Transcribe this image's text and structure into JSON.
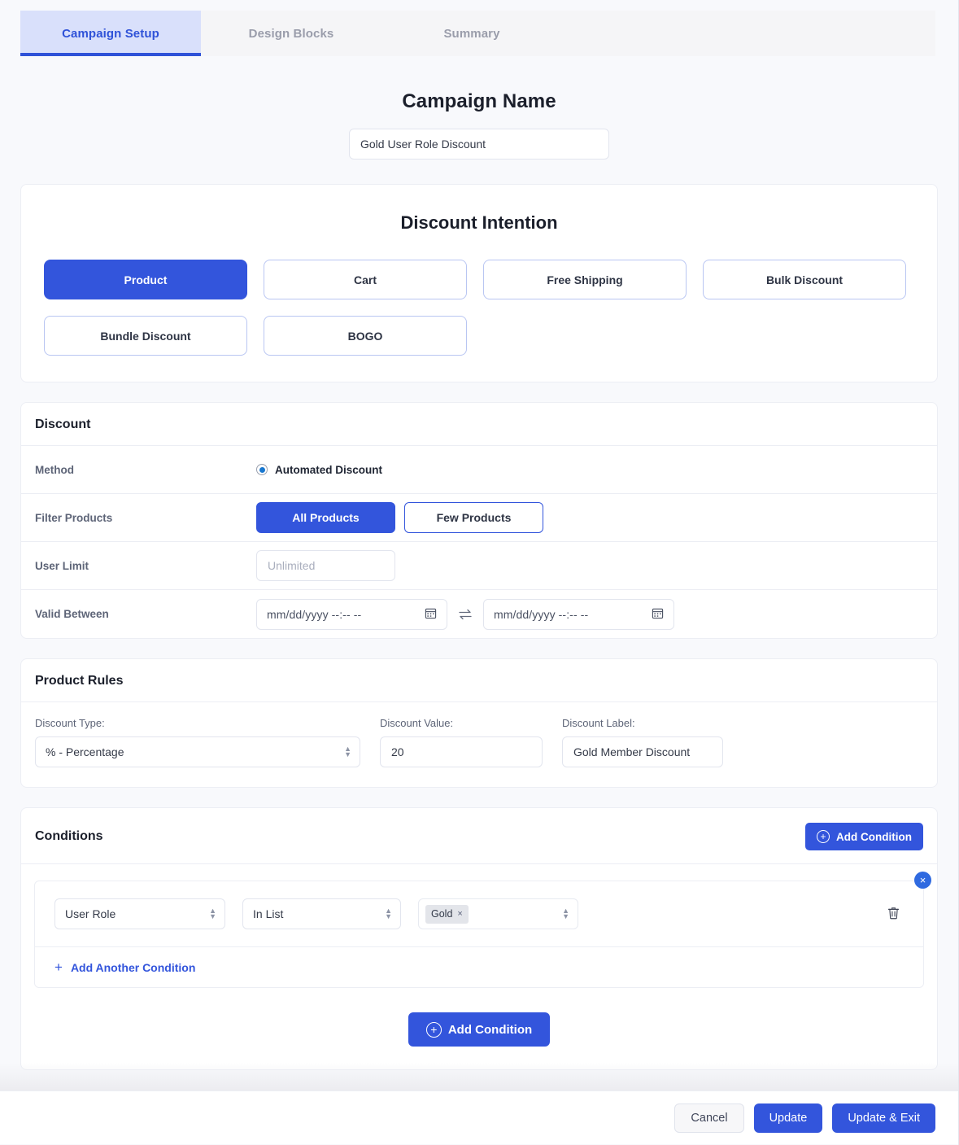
{
  "tabs": [
    {
      "label": "Campaign Setup",
      "active": true
    },
    {
      "label": "Design Blocks",
      "active": false
    },
    {
      "label": "Summary",
      "active": false
    }
  ],
  "campaign": {
    "title": "Campaign Name",
    "name_value": "Gold User Role Discount",
    "name_placeholder": "Campaign Name"
  },
  "intention": {
    "title": "Discount Intention",
    "options": [
      {
        "label": "Product",
        "selected": true
      },
      {
        "label": "Cart",
        "selected": false
      },
      {
        "label": "Free Shipping",
        "selected": false
      },
      {
        "label": "Bulk Discount",
        "selected": false
      },
      {
        "label": "Bundle Discount",
        "selected": false
      },
      {
        "label": "BOGO",
        "selected": false
      }
    ]
  },
  "discount": {
    "section_title": "Discount",
    "method_label": "Method",
    "method_option": "Automated Discount",
    "filter_label": "Filter Products",
    "filter_all": "All Products",
    "filter_few": "Few Products",
    "user_limit_label": "User Limit",
    "user_limit_placeholder": "Unlimited",
    "user_limit_value": "",
    "valid_between_label": "Valid Between",
    "date_from_placeholder": "mm/dd/yyyy --:-- --",
    "date_to_placeholder": "mm/dd/yyyy --:-- --"
  },
  "product_rules": {
    "section_title": "Product Rules",
    "discount_type_label": "Discount Type:",
    "discount_type_value": "% - Percentage",
    "discount_value_label": "Discount Value:",
    "discount_value_value": "20",
    "discount_label_label": "Discount Label:",
    "discount_label_value": "Gold Member Discount"
  },
  "conditions": {
    "section_title": "Conditions",
    "add_condition_header": "Add Condition",
    "add_another": "Add Another Condition",
    "add_condition_footer": "Add Condition",
    "close_group": "×",
    "row": {
      "field_value": "User Role",
      "operator_value": "In List",
      "chip_value": "Gold",
      "chip_remove": "×"
    }
  },
  "footer": {
    "cancel": "Cancel",
    "update": "Update",
    "update_exit": "Update & Exit"
  },
  "colors": {
    "primary": "#3355dc",
    "tab_active_bg": "#d9e0fb",
    "tab_active_text": "#2f52d8",
    "close_badge": "#2f6ae0",
    "radio_dot": "#1877cf"
  }
}
